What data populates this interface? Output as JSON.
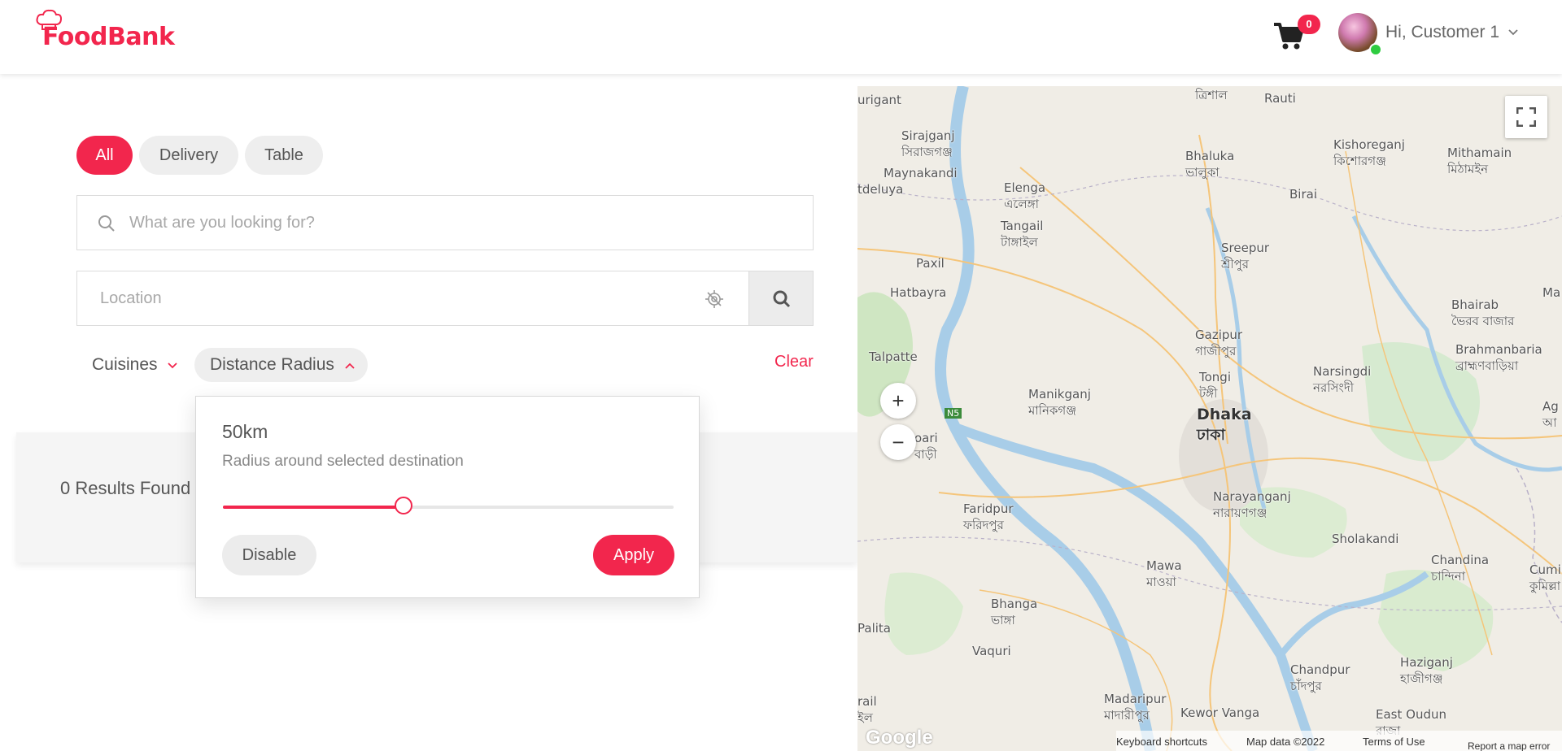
{
  "header": {
    "logo_text": "FoodBank",
    "cart_count": "0",
    "greeting": "Hi, Customer 1"
  },
  "filters": {
    "tabs": [
      {
        "label": "All",
        "active": true
      },
      {
        "label": "Delivery",
        "active": false
      },
      {
        "label": "Table",
        "active": false
      }
    ],
    "search_placeholder": "What are you looking for?",
    "location_placeholder": "Location",
    "cuisines_label": "Cuisines",
    "distance_label": "Distance Radius",
    "clear_label": "Clear"
  },
  "results": {
    "text": "0 Results Found"
  },
  "radius_popup": {
    "value_label": "50km",
    "description": "Radius around selected destination",
    "slider_fraction": 0.5,
    "disable_label": "Disable",
    "apply_label": "Apply"
  },
  "map": {
    "labels": [
      {
        "text": "Sirajganj",
        "sub": "সিরাজগঞ্জ"
      },
      {
        "text": "Maynakandi"
      },
      {
        "text": "Elenga",
        "sub": "এলেঙ্গা"
      },
      {
        "text": "Tangail",
        "sub": "টাঙ্গাইল"
      },
      {
        "text": "Bhaluka",
        "sub": "ভালুকা"
      },
      {
        "text": "Kishoreganj",
        "sub": "কিশোরগঞ্জ"
      },
      {
        "text": "Mithamain",
        "sub": "মিঠামইন"
      },
      {
        "text": "Rauti"
      },
      {
        "text": "Birai"
      },
      {
        "text": "Sreepur",
        "sub": "শ্রীপুর"
      },
      {
        "text": "Paxil"
      },
      {
        "text": "Hatbayra"
      },
      {
        "text": "Bhairab",
        "sub": "ভৈরব বাজার"
      },
      {
        "text": "Brahmanbaria",
        "sub": "ব্রাহ্মণবাড়িয়া"
      },
      {
        "text": "Gazipur",
        "sub": "গাজীপুর"
      },
      {
        "text": "Talpatte"
      },
      {
        "text": "Tongi",
        "sub": "টঙ্গী"
      },
      {
        "text": "Narsingdi",
        "sub": "নরসিংদী"
      },
      {
        "text": "Manikganj",
        "sub": "মানিকগঞ্জ"
      },
      {
        "text": "Dhaka",
        "sub": "ঢাকা"
      },
      {
        "text": "Narayanganj",
        "sub": "নারায়ণগঞ্জ"
      },
      {
        "text": "Faridpur",
        "sub": "ফরিদপুর"
      },
      {
        "text": "Sholakandi"
      },
      {
        "text": "Mawa",
        "sub": "মাওয়া"
      },
      {
        "text": "Chandina",
        "sub": "চান্দিনা"
      },
      {
        "text": "Cumilla",
        "sub": "কুমিল্লা"
      },
      {
        "text": "Bhanga",
        "sub": "ভাঙ্গা"
      },
      {
        "text": "Palita"
      },
      {
        "text": "Vaquri"
      },
      {
        "text": "Haziganj",
        "sub": "হাজীগঞ্জ"
      },
      {
        "text": "Chandpur",
        "sub": "চাঁদপুর"
      },
      {
        "text": "Madaripur",
        "sub": "মাদারীপুর"
      },
      {
        "text": "Kewor Vanga"
      },
      {
        "text": "East Oudun",
        "sub": "রাজা"
      },
      {
        "text": "urigant"
      },
      {
        "text": "tdeluya"
      },
      {
        "text": "ত্রিশাল"
      },
      {
        "text": "N5"
      },
      {
        "text": "oari",
        "sub": "বাড়ী"
      },
      {
        "text": "Ma"
      },
      {
        "text": "Ag",
        "sub": "আ"
      },
      {
        "text": "rail",
        "sub": "ইল"
      }
    ],
    "zoom_in": "+",
    "zoom_out": "−",
    "footer": {
      "shortcuts": "Keyboard shortcuts",
      "map_data": "Map data ©2022",
      "terms": "Terms of Use",
      "report": "Report a map error"
    },
    "google_logo": "Google"
  }
}
